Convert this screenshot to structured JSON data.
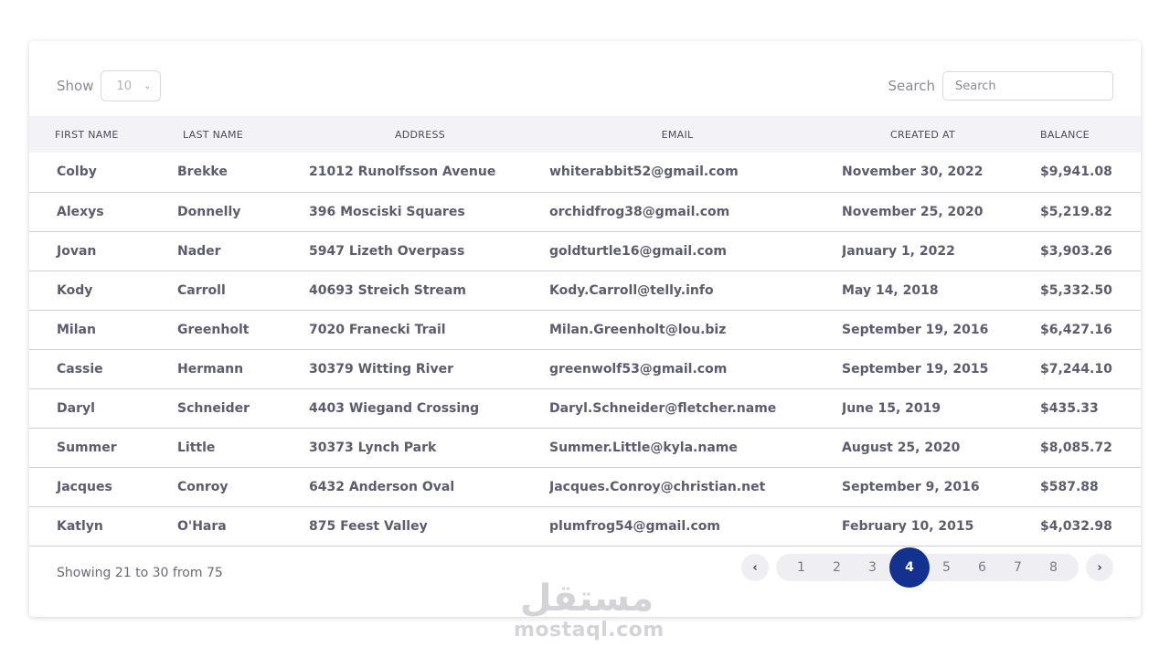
{
  "toolbar": {
    "show_label": "Show",
    "page_size": "10",
    "search_label": "Search",
    "search_placeholder": "Search",
    "search_value": ""
  },
  "table": {
    "columns": [
      "FIRST NAME",
      "LAST NAME",
      "ADDRESS",
      "EMAIL",
      "CREATED AT",
      "BALANCE"
    ],
    "rows": [
      [
        "Colby",
        "Brekke",
        "21012 Runolfsson Avenue",
        "whiterabbit52@gmail.com",
        "November 30, 2022",
        "$9,941.08"
      ],
      [
        "Alexys",
        "Donnelly",
        "396 Mosciski Squares",
        "orchidfrog38@gmail.com",
        "November 25, 2020",
        "$5,219.82"
      ],
      [
        "Jovan",
        "Nader",
        "5947 Lizeth Overpass",
        "goldturtle16@gmail.com",
        "January 1, 2022",
        "$3,903.26"
      ],
      [
        "Kody",
        "Carroll",
        "40693 Streich Stream",
        "Kody.Carroll@telly.info",
        "May 14, 2018",
        "$5,332.50"
      ],
      [
        "Milan",
        "Greenholt",
        "7020 Franecki Trail",
        "Milan.Greenholt@lou.biz",
        "September 19, 2016",
        "$6,427.16"
      ],
      [
        "Cassie",
        "Hermann",
        "30379 Witting River",
        "greenwolf53@gmail.com",
        "September 19, 2015",
        "$7,244.10"
      ],
      [
        "Daryl",
        "Schneider",
        "4403 Wiegand Crossing",
        "Daryl.Schneider@fletcher.name",
        "June 15, 2019",
        "$435.33"
      ],
      [
        "Summer",
        "Little",
        "30373 Lynch Park",
        "Summer.Little@kyla.name",
        "August 25, 2020",
        "$8,085.72"
      ],
      [
        "Jacques",
        "Conroy",
        "6432 Anderson Oval",
        "Jacques.Conroy@christian.net",
        "September 9, 2016",
        "$587.88"
      ],
      [
        "Katlyn",
        "O'Hara",
        "875 Feest Valley",
        "plumfrog54@gmail.com",
        "February 10, 2015",
        "$4,032.98"
      ]
    ]
  },
  "footer": {
    "showing_text": "Showing 21 to 30 from 75",
    "pages": [
      "1",
      "2",
      "3",
      "4",
      "5",
      "6",
      "7",
      "8"
    ],
    "active_page": "4",
    "prev_icon": "chevron-left-icon",
    "next_icon": "chevron-right-icon"
  },
  "watermark": {
    "arabic": "مستقل",
    "latin": "mostaql.com"
  },
  "colors": {
    "accent": "#13318f",
    "header_bg": "#f3f3f7",
    "row_border": "#cfcfd6"
  }
}
